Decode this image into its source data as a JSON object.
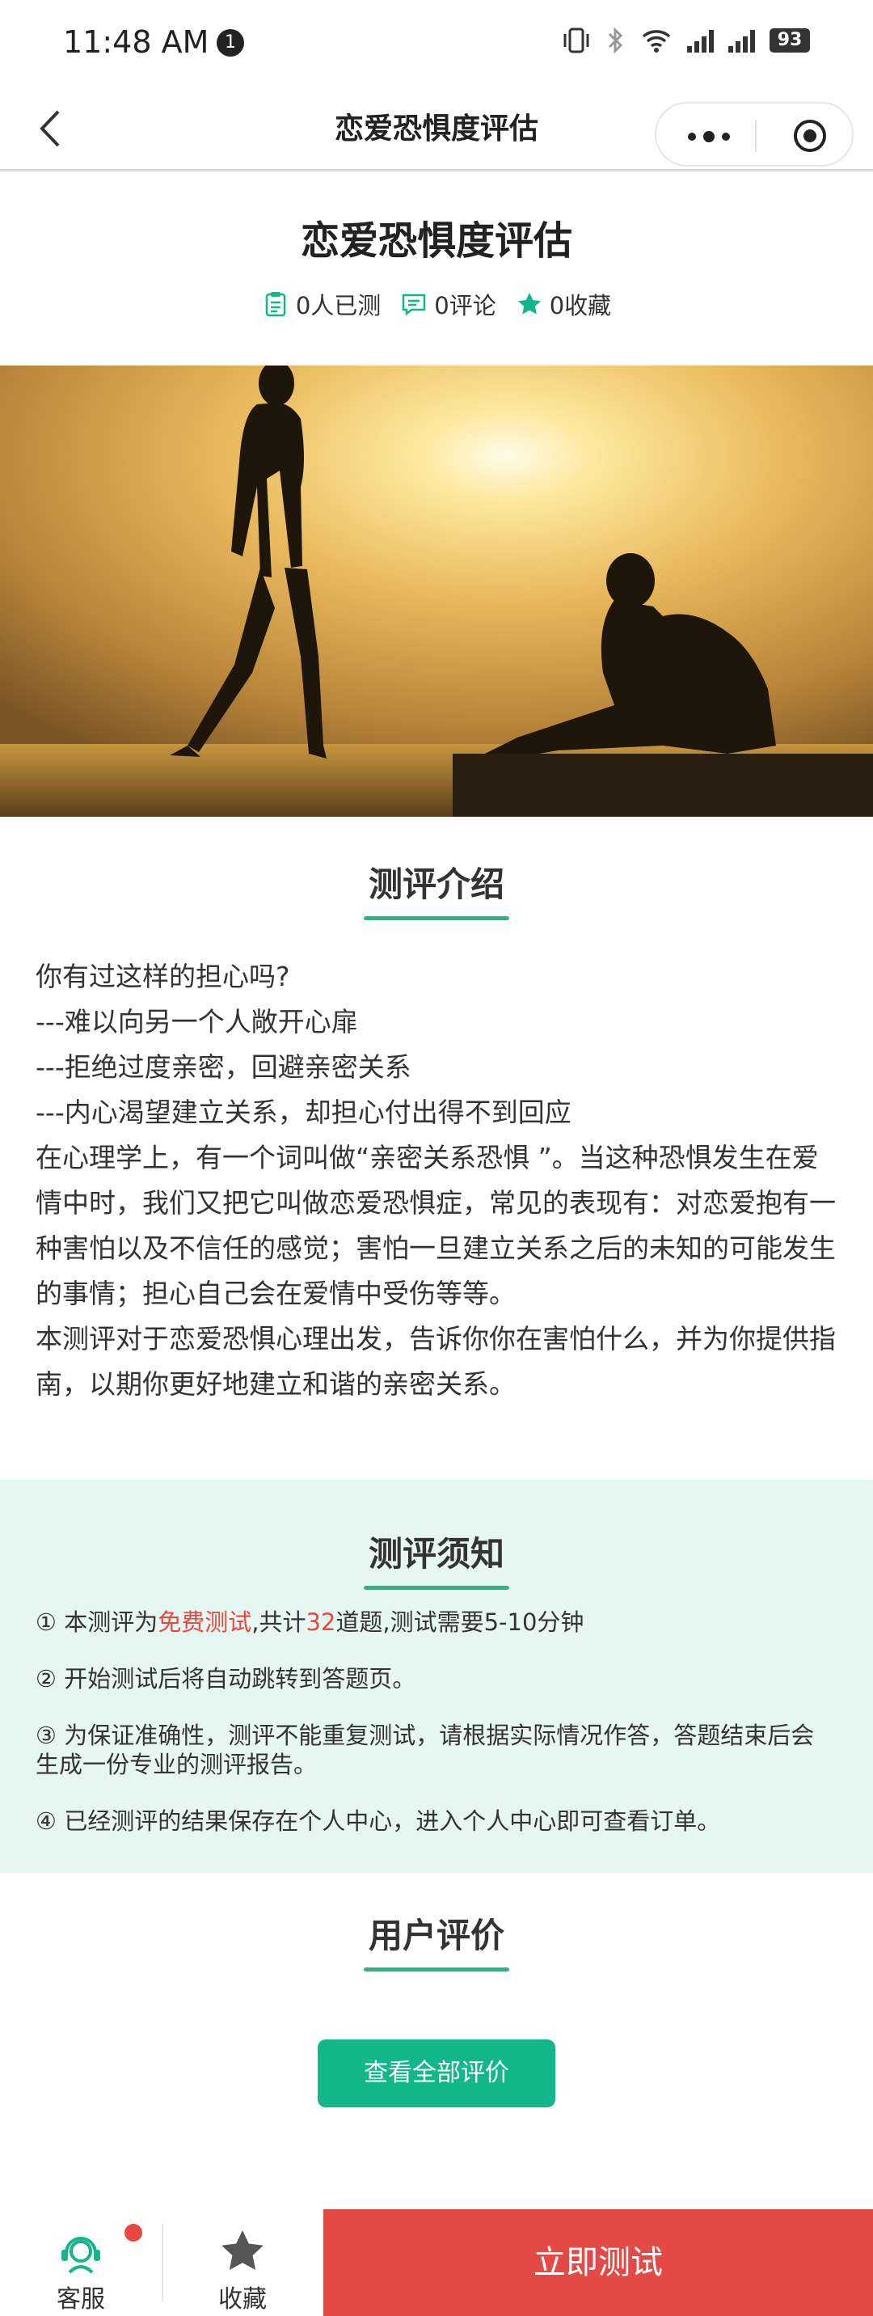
{
  "status_bar": {
    "time": "11:48 AM",
    "notification_count": "1",
    "battery": "93"
  },
  "nav": {
    "title": "恋爱恐惧度评估"
  },
  "header": {
    "title": "恋爱恐惧度评估",
    "tested": "0人已测",
    "comments": "0评论",
    "favorites": "0收藏"
  },
  "intro": {
    "heading": "测评介绍",
    "paragraphs": [
      "你有过这样的担心吗?",
      "---难以向另一个人敞开心扉",
      "---拒绝过度亲密，回避亲密关系",
      "---内心渴望建立关系，却担心付出得不到回应",
      "在心理学上，有一个词叫做“亲密关系恐惧 ”。当这种恐惧发生在爱情中时，我们又把它叫做恋爱恐惧症，常见的表现有：对恋爱抱有一种害怕以及不信任的感觉；害怕一旦建立关系之后的未知的可能发生的事情；担心自己会在爱情中受伤等等。",
      "本测评对于恋爱恐惧心理出发，告诉你你在害怕什么，并为你提供指南，以期你更好地建立和谐的亲密关系。"
    ]
  },
  "notice": {
    "heading": "测评须知",
    "item1": {
      "prefix": "① 本测评为",
      "free": "免费测试",
      "middle": ",共计",
      "count": "32",
      "suffix": "道题,测试需要5-10分钟"
    },
    "item2": "② 开始测试后将自动跳转到答题页。",
    "item3": "③ 为保证准确性，测评不能重复测试，请根据实际情况作答，答题结束后会生成一份专业的测评报告。",
    "item4": "④ 已经测评的结果保存在个人中心，进入个人中心即可查看订单。"
  },
  "reviews": {
    "heading": "用户评价",
    "button": "查看全部评价"
  },
  "bottom": {
    "service": "客服",
    "favorite": "收藏",
    "start": "立即测试"
  },
  "colors": {
    "accent": "#13b58a",
    "highlight": "#e8483d",
    "start_button": "#e34a45",
    "notice_bg": "#e6f7f1"
  }
}
